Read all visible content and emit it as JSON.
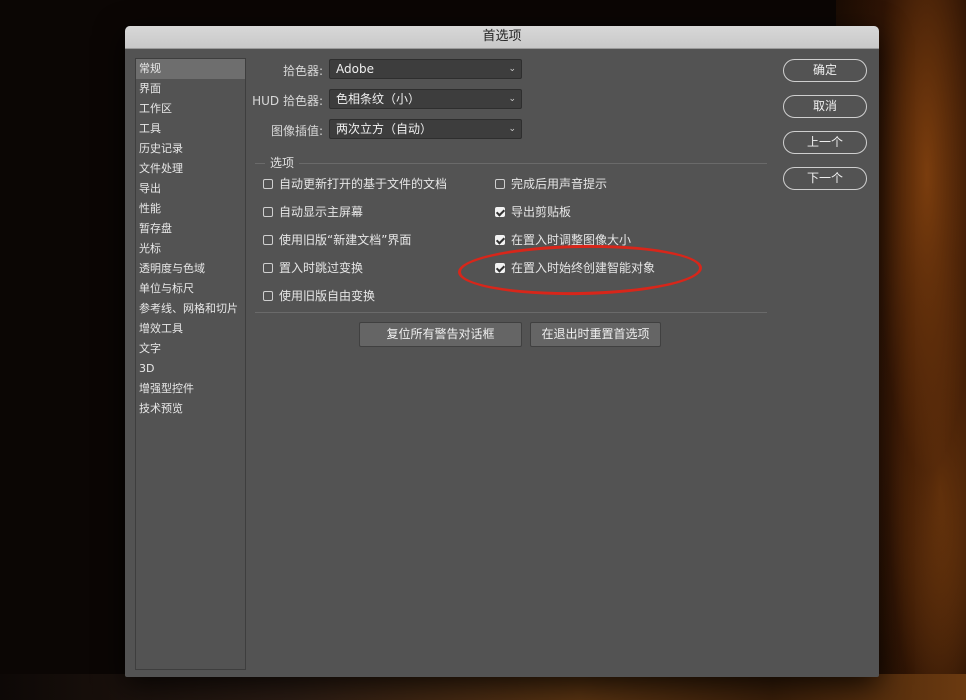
{
  "dialog": {
    "title": "首选项"
  },
  "sidebar": {
    "items": [
      "常规",
      "界面",
      "工作区",
      "工具",
      "历史记录",
      "文件处理",
      "导出",
      "性能",
      "暂存盘",
      "光标",
      "透明度与色域",
      "单位与标尺",
      "参考线、网格和切片",
      "增效工具",
      "文字",
      "3D",
      "增强型控件",
      "技术预览"
    ],
    "active_index": 0
  },
  "fields": [
    {
      "label": "拾色器:",
      "value": "Adobe"
    },
    {
      "label": "HUD 拾色器:",
      "value": "色相条纹（小）"
    },
    {
      "label": "图像插值:",
      "value": "两次立方（自动）"
    }
  ],
  "options": {
    "title": "选项",
    "left": [
      {
        "label": "自动更新打开的基于文件的文档",
        "checked": false
      },
      {
        "label": "自动显示主屏幕",
        "checked": false
      },
      {
        "label": "使用旧版“新建文档”界面",
        "checked": false
      },
      {
        "label": "置入时跳过变换",
        "checked": false
      },
      {
        "label": "使用旧版自由变换",
        "checked": false
      }
    ],
    "right": [
      {
        "label": "完成后用声音提示",
        "checked": false
      },
      {
        "label": "导出剪贴板",
        "checked": true
      },
      {
        "label": "在置入时调整图像大小",
        "checked": true
      },
      {
        "label": "在置入时始终创建智能对象",
        "checked": true
      }
    ]
  },
  "buttons": {
    "ok": "确定",
    "cancel": "取消",
    "prev": "上一个",
    "next": "下一个",
    "reset_warnings": "复位所有警告对话框",
    "reset_prefs": "在退出时重置首选项"
  },
  "colors": {
    "dialog_bg": "#535353",
    "annotation": "#d8261a"
  }
}
